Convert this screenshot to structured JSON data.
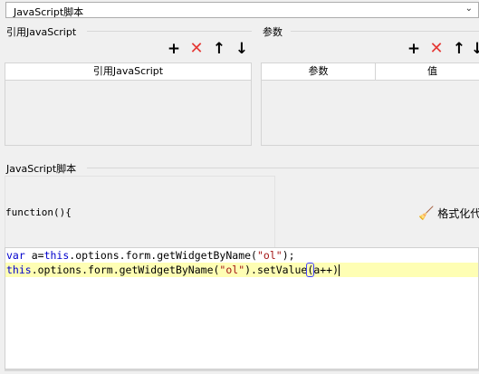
{
  "script_type_select": {
    "value": "JavaScript脚本",
    "arrow": "⌄"
  },
  "references": {
    "title": "引用JavaScript",
    "toolbar": {
      "add": "+",
      "delete": "✕",
      "up": "↑",
      "down": "↓"
    },
    "columns": [
      "引用JavaScript"
    ]
  },
  "params": {
    "title": "参数",
    "toolbar": {
      "add": "+",
      "delete": "✕",
      "up": "↑",
      "down": "↓"
    },
    "columns": [
      "参数",
      "值"
    ]
  },
  "script": {
    "title": "JavaScript脚本",
    "function_signature": "function(){",
    "format_button_label": "格式化代",
    "code": {
      "line1": {
        "kw": "var",
        "a": " a=",
        "this": "this",
        "b": ".options.form.getWidgetByName(",
        "str": "\"ol\"",
        "c": ");"
      },
      "line2": {
        "this": "this",
        "b": ".options.form.getWidgetByName(",
        "str": "\"ol\"",
        "c": ").setValue",
        "open": "(",
        "d": "a++",
        "close": ")"
      }
    }
  }
}
